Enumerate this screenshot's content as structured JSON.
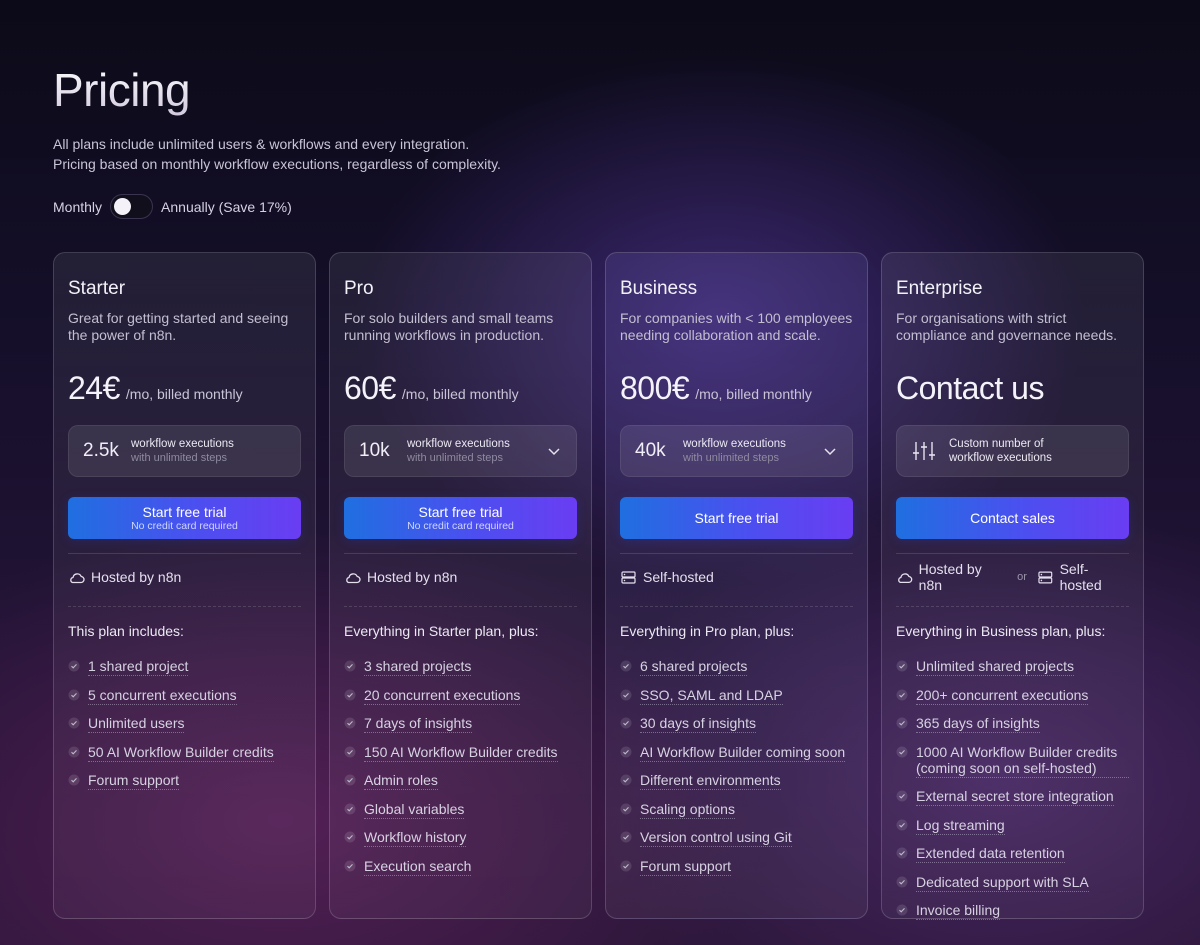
{
  "header": {
    "title": "Pricing",
    "subtitle_line1": "All plans include unlimited users & workflows and every integration.",
    "subtitle_line2": "Pricing based on monthly workflow executions, regardless of complexity."
  },
  "billing": {
    "monthly_label": "Monthly",
    "annual_label": "Annually (Save 17%)",
    "annual_selected": false
  },
  "plans": [
    {
      "name": "Starter",
      "description": "Great for getting started and seeing the power of n8n.",
      "price": "24€",
      "period": "/mo, billed monthly",
      "exec_count": "2.5k",
      "exec_line1": "workflow executions",
      "exec_line2": "with unlimited steps",
      "cta_main": "Start free trial",
      "cta_sub": "No credit card required",
      "hosting": "Hosted by n8n",
      "includes_title": "This plan includes:",
      "features": [
        "1 shared project",
        "5 concurrent executions",
        "Unlimited users",
        "50 AI Workflow Builder credits",
        "Forum support"
      ]
    },
    {
      "name": "Pro",
      "description": "For solo builders and small teams running workflows in production.",
      "price": "60€",
      "period": "/mo, billed monthly",
      "exec_count": "10k",
      "exec_line1": "workflow executions",
      "exec_line2": "with unlimited steps",
      "cta_main": "Start free trial",
      "cta_sub": "No credit card required",
      "hosting": "Hosted by n8n",
      "includes_title": "Everything in Starter plan, plus:",
      "features": [
        "3 shared projects",
        "20 concurrent executions",
        "7 days of insights",
        "150 AI Workflow Builder credits",
        "Admin roles",
        "Global variables",
        "Workflow history",
        "Execution search"
      ]
    },
    {
      "name": "Business",
      "description": "For companies with < 100 employees needing collaboration and scale.",
      "price": "800€",
      "period": "/mo, billed monthly",
      "exec_count": "40k",
      "exec_line1": "workflow executions",
      "exec_line2": "with unlimited steps",
      "cta_main": "Start free trial",
      "hosting": "Self-hosted",
      "includes_title": "Everything in Pro plan, plus:",
      "features": [
        "6 shared projects",
        "SSO, SAML and LDAP",
        "30 days of insights",
        "AI Workflow Builder coming soon",
        "Different environments",
        "Scaling options",
        "Version control using Git",
        "Forum support"
      ]
    },
    {
      "name": "Enterprise",
      "description": "For organisations with strict compliance and governance needs.",
      "price": "Contact us",
      "exec_line1": "Custom number of",
      "exec_line2": "workflow executions",
      "cta_main": "Contact sales",
      "hosting": "Hosted by n8n",
      "hosting_or": "or",
      "hosting_alt": "Self-hosted",
      "includes_title": "Everything in Business plan, plus:",
      "features": [
        "Unlimited shared projects",
        "200+ concurrent executions",
        "365 days of insights",
        "1000 AI Workflow Builder credits (coming soon on self-hosted)",
        "External secret store integration",
        "Log streaming",
        "Extended data retention",
        "Dedicated support with SLA",
        "Invoice billing"
      ]
    }
  ]
}
